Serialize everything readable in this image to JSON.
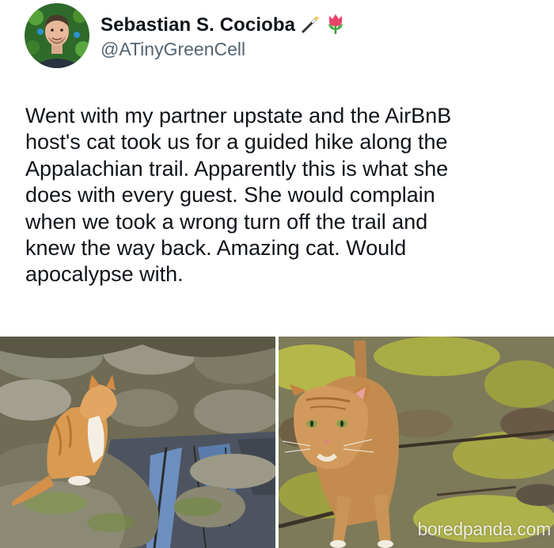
{
  "tweet": {
    "author_name": "Sebastian S. Cocioba",
    "author_emojis": [
      "wand-emoji",
      "tulip-emoji"
    ],
    "handle": "@ATinyGreenCell",
    "lines": [
      "Went with my partner upstate and the AirBnB",
      "host's cat took us for a guided hike along the",
      "Appalachian trail. Apparently this is what she",
      "does with every guest. She would complain",
      "when we took a wrong turn off the trail and",
      "knew the way back. Amazing cat. Would",
      "apocalypse with."
    ]
  },
  "media": {
    "watermark": "boredpanda.com"
  },
  "colors": {
    "text": "#0f1419",
    "handle": "#536471",
    "background": "#ffffff"
  }
}
